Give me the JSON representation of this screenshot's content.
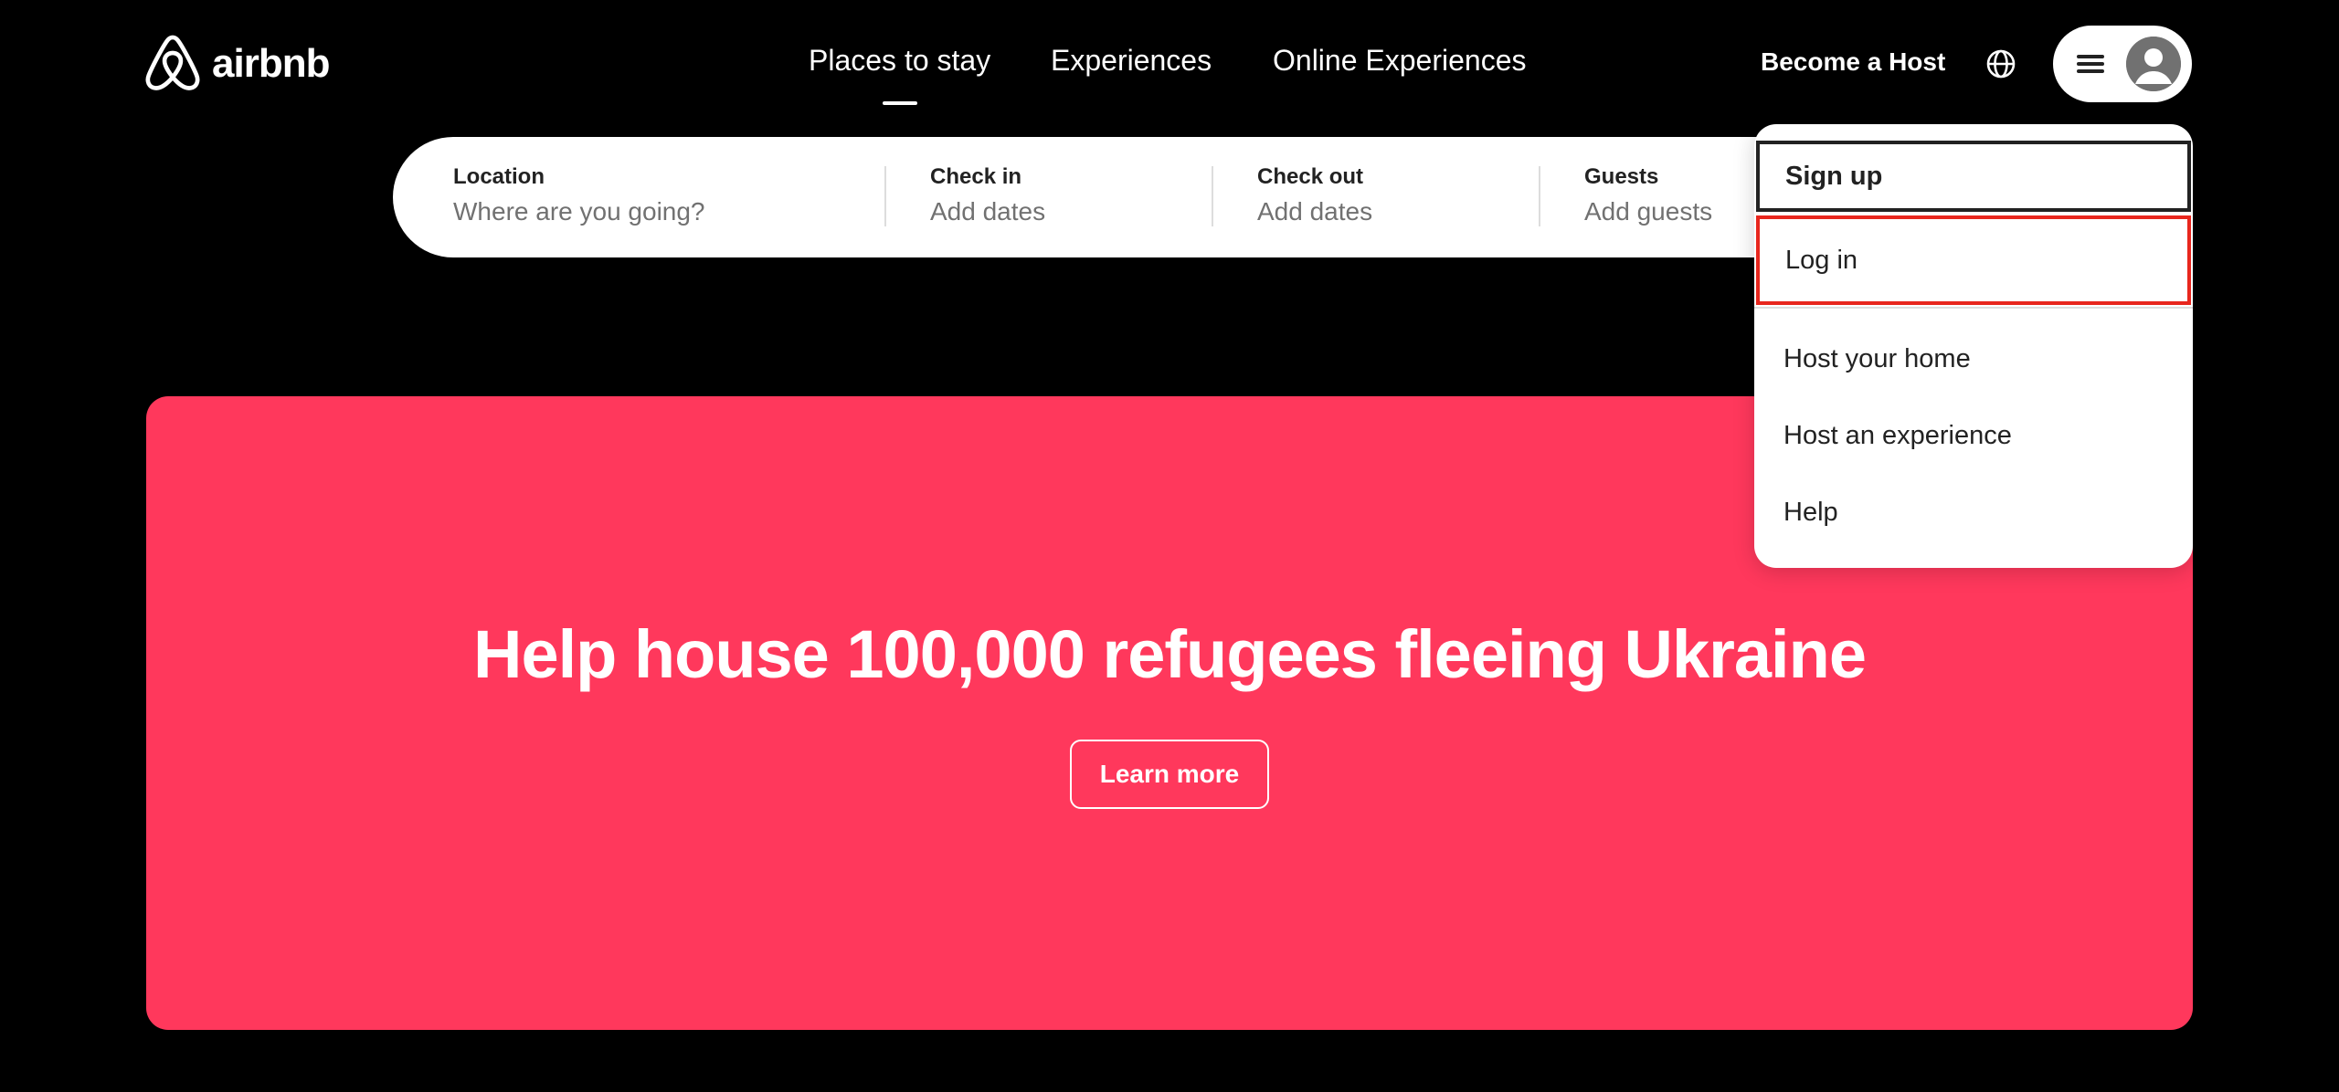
{
  "brand": {
    "logo_text": "airbnb",
    "logo_icon": "airbnb-belo-icon",
    "accent_color": "#ff385c"
  },
  "nav": {
    "items": [
      {
        "label": "Places to stay",
        "active": true
      },
      {
        "label": "Experiences",
        "active": false
      },
      {
        "label": "Online Experiences",
        "active": false
      }
    ]
  },
  "header": {
    "become_host_label": "Become a Host",
    "globe_icon": "globe-icon",
    "menu_icon": "hamburger-menu-icon",
    "avatar_icon": "user-avatar-icon"
  },
  "search": {
    "location": {
      "label": "Location",
      "placeholder": "Where are you going?"
    },
    "check_in": {
      "label": "Check in",
      "placeholder": "Add dates"
    },
    "check_out": {
      "label": "Check out",
      "placeholder": "Add dates"
    },
    "guests": {
      "label": "Guests",
      "placeholder": "Add guests"
    }
  },
  "dropdown": {
    "items": [
      {
        "label": "Sign up"
      },
      {
        "label": "Log in"
      },
      {
        "label": "Host your home"
      },
      {
        "label": "Host an experience"
      },
      {
        "label": "Help"
      }
    ],
    "highlight_color": "#e8261d"
  },
  "banner": {
    "title": "Help house 100,000 refugees fleeing Ukraine",
    "button_label": "Learn more",
    "background_color": "#ff385c"
  }
}
